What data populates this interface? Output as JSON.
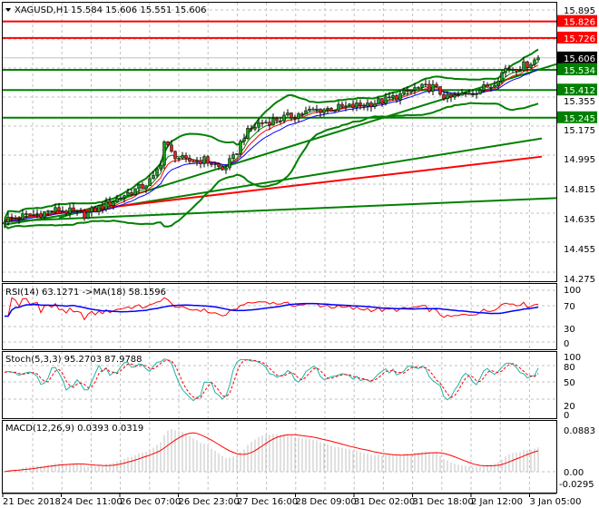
{
  "header": {
    "symbol": "XAGUSD,H1",
    "ohlc": "15.584 15.606 15.551 15.606",
    "menu_icon": "triangle-down-icon"
  },
  "colors": {
    "bull": "#1a9b1a",
    "bear": "#e02020",
    "level_red": "#ff0000",
    "level_green": "#008000",
    "ma_blue": "#0000ff",
    "rsi": "#ff0000",
    "stoch_main": "#20b2aa",
    "stoch_signal": "#ff0000",
    "macd_hist": "#c0c0c0",
    "macd_signal": "#ff0000",
    "price_tag": "#000000"
  },
  "chart_data": {
    "type": "candlestick",
    "title": "XAGUSD,H1",
    "bars": 148,
    "close_anchors": [
      [
        0,
        14.63
      ],
      [
        8,
        14.66
      ],
      [
        15,
        14.69
      ],
      [
        22,
        14.66
      ],
      [
        28,
        14.72
      ],
      [
        33,
        14.78
      ],
      [
        38,
        14.83
      ],
      [
        41,
        14.88
      ],
      [
        43,
        14.98
      ],
      [
        44,
        15.1
      ],
      [
        46,
        15.03
      ],
      [
        50,
        14.98
      ],
      [
        55,
        14.99
      ],
      [
        58,
        14.96
      ],
      [
        60,
        14.93
      ],
      [
        63,
        15.0
      ],
      [
        66,
        15.14
      ],
      [
        70,
        15.21
      ],
      [
        78,
        15.25
      ],
      [
        85,
        15.29
      ],
      [
        95,
        15.31
      ],
      [
        105,
        15.35
      ],
      [
        110,
        15.39
      ],
      [
        113,
        15.42
      ],
      [
        118,
        15.43
      ],
      [
        122,
        15.36
      ],
      [
        126,
        15.38
      ],
      [
        130,
        15.41
      ],
      [
        134,
        15.44
      ],
      [
        138,
        15.54
      ],
      [
        142,
        15.55
      ],
      [
        145,
        15.58
      ],
      [
        147,
        15.606
      ]
    ],
    "last_ohlc": [
      15.584,
      15.606,
      15.551,
      15.606
    ],
    "price_axis": {
      "ylim": [
        14.275,
        15.895
      ],
      "ticks": [
        "15.895",
        "15.175",
        "14.995",
        "14.815",
        "14.635",
        "14.455",
        "14.275",
        "15.355"
      ]
    },
    "levels": [
      {
        "price": 15.826,
        "label": "15.826",
        "color": "red"
      },
      {
        "price": 15.726,
        "label": "15.726",
        "color": "red"
      },
      {
        "price": 15.534,
        "label": "15.534",
        "color": "green"
      },
      {
        "price": 15.412,
        "label": "15.412",
        "color": "green"
      },
      {
        "price": 15.245,
        "label": "15.245",
        "color": "green"
      }
    ],
    "current_price": "15.606",
    "trend_lines": [
      {
        "from": [
          0,
          14.62
        ],
        "to": [
          152,
          14.76
        ],
        "color": "green"
      },
      {
        "from": [
          0,
          14.6
        ],
        "to": [
          148,
          15.12
        ],
        "color": "green"
      },
      {
        "from": [
          15,
          14.64
        ],
        "to": [
          155,
          15.58
        ],
        "color": "green"
      },
      {
        "from": [
          0,
          14.63
        ],
        "to": [
          148,
          15.01
        ],
        "color": "red"
      }
    ],
    "x_tick_labels": [
      "21 Dec 2018",
      "24 Dec 11:00",
      "26 Dec 07:00",
      "26 Dec 23:00",
      "27 Dec 16:00",
      "28 Dec 09:00",
      "31 Dec 02:00",
      "31 Dec 18:00",
      "2 Jan 12:00",
      "3 Jan 05:00"
    ],
    "indicators": {
      "rsi": {
        "title": "RSI(14) 63.1271  ->MA(18) 58.1596",
        "ticks": [
          "100",
          "70",
          "30",
          "0"
        ],
        "ylim": [
          0,
          100
        ]
      },
      "stoch": {
        "title": "Stoch(5,3,3) 95.2703 87.9788",
        "ticks": [
          "100",
          "80",
          "50",
          "20",
          "0"
        ],
        "ylim": [
          0,
          100
        ]
      },
      "macd": {
        "title": "MACD(12,26,9) 0.0393 0.0319",
        "ticks": [
          "0.0883",
          "0.00",
          "-0.0295"
        ],
        "ylim": [
          -0.0295,
          0.0883
        ]
      }
    }
  }
}
